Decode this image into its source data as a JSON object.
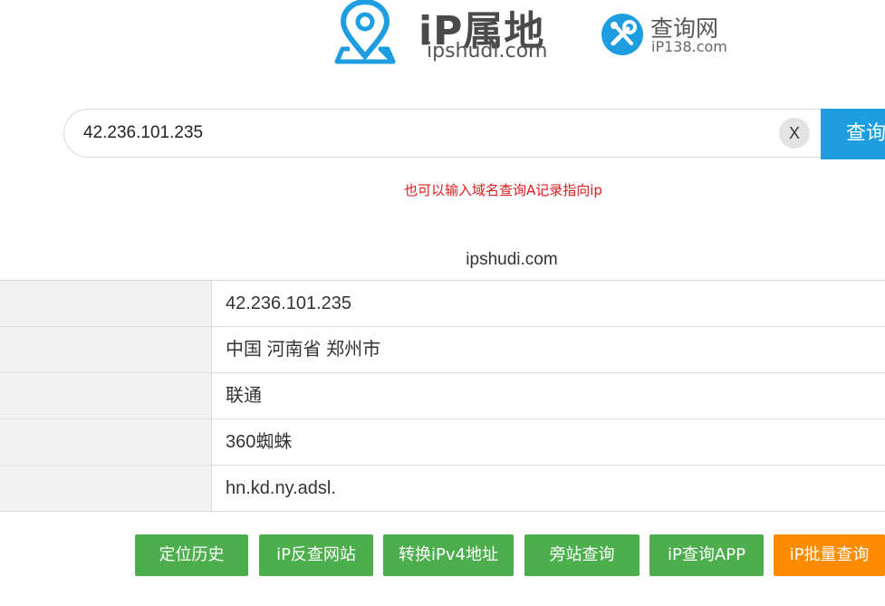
{
  "header": {
    "logo_title": "iP属地",
    "logo_domain": "ipshudi.com",
    "partner_name": "查询网",
    "partner_domain": "iP138.com",
    "logo_color": "#1e9ee1"
  },
  "search": {
    "value": "42.236.101.235",
    "clear_label": "X",
    "button_label": "查询",
    "hint": "也可以输入域名查询A记录指向ip",
    "hint_color": "#e0191d"
  },
  "result": {
    "caption": "ipshudi.com",
    "rows": [
      {
        "value": "42.236.101.235"
      },
      {
        "value": "中国 河南省 郑州市"
      },
      {
        "value": "联通"
      },
      {
        "value": "360蜘蛛"
      },
      {
        "value": "hn.kd.ny.adsl."
      }
    ]
  },
  "actions": [
    {
      "label": "定位历史",
      "color": "#4cae4c"
    },
    {
      "label": "iP反查网站",
      "color": "#4cae4c"
    },
    {
      "label": "转换iPv4地址",
      "color": "#4cae4c"
    },
    {
      "label": "旁站查询",
      "color": "#4cae4c"
    },
    {
      "label": "iP查询APP",
      "color": "#4cae4c"
    },
    {
      "label": "iP批量查询",
      "color": "#ff8c00"
    }
  ]
}
